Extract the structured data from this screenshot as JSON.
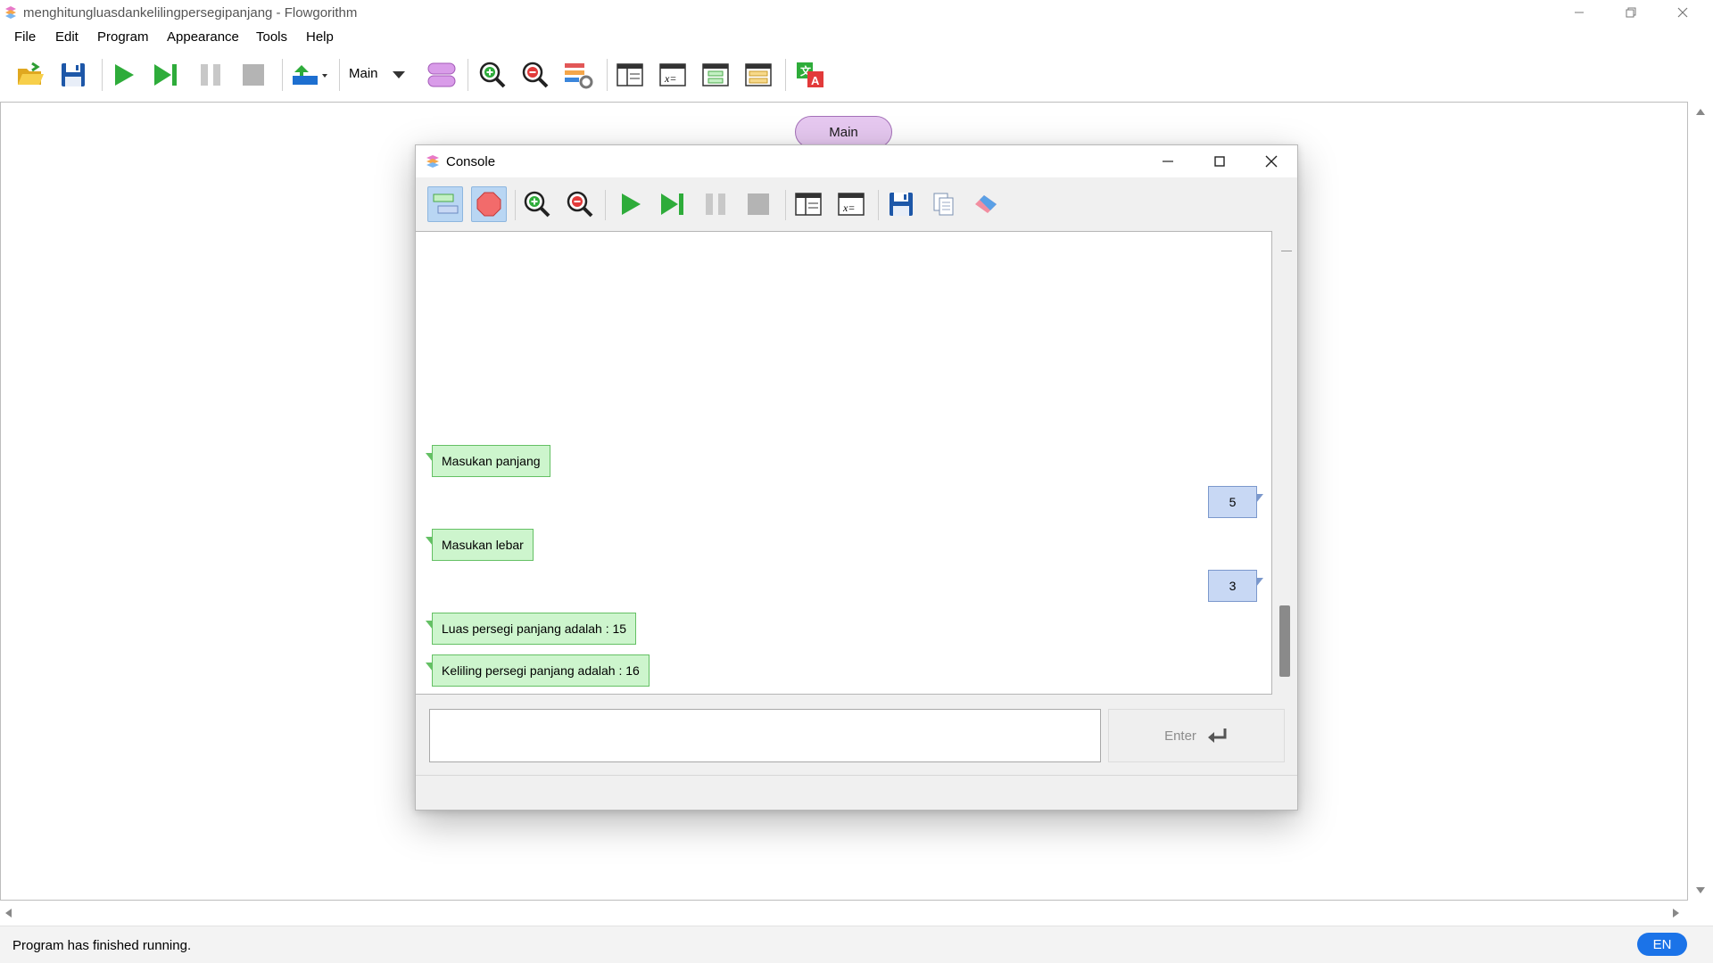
{
  "window": {
    "title": "menghitungluasdankelilingpersegipanjang - Flowgorithm"
  },
  "menu": {
    "items": [
      "File",
      "Edit",
      "Program",
      "Appearance",
      "Tools",
      "Help"
    ]
  },
  "toolbar": {
    "function_selector": "Main"
  },
  "canvas": {
    "start_label": "Main"
  },
  "console": {
    "title": "Console",
    "outputs": [
      "Masukan panjang",
      "Masukan lebar",
      "Luas persegi panjang adalah : 15",
      "Keliling persegi panjang adalah : 16"
    ],
    "inputs": [
      "5",
      "3"
    ],
    "input_value": "",
    "enter_label": "Enter"
  },
  "status": {
    "text": "Program has finished running.",
    "language": "EN"
  },
  "colors": {
    "output_bubble": "#cdf5cd",
    "input_bubble": "#c8d8f4",
    "start_oval": "#e6c8f0",
    "language_badge": "#1b73e8"
  }
}
